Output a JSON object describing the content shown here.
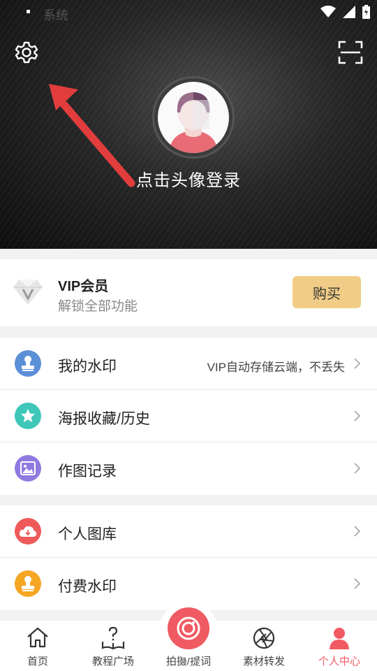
{
  "status_bar": {
    "app_label": "系统"
  },
  "header": {
    "login_prompt": "点击头像登录"
  },
  "vip": {
    "title": "VIP会员",
    "subtitle": "解锁全部功能",
    "buy_label": "购买"
  },
  "group1": [
    {
      "label": "我的水印",
      "note": "VIP自动存储云端，不丢失",
      "icon": "stamp-icon",
      "color": "#5b8fd6"
    },
    {
      "label": "海报收藏/历史",
      "note": "",
      "icon": "star-icon",
      "color": "#3fc7b9"
    },
    {
      "label": "作图记录",
      "note": "",
      "icon": "image-icon",
      "color": "#8f7be0"
    }
  ],
  "group2": [
    {
      "label": "个人图库",
      "icon": "cloud-download-icon",
      "color": "#ee5a5a"
    },
    {
      "label": "付费水印",
      "icon": "stamp-icon",
      "color": "#f5a623"
    }
  ],
  "tabbar": {
    "home": "首页",
    "tutorial": "教程广场",
    "shoot": "拍摄/提词",
    "material": "素材转发",
    "profile": "个人中心",
    "active_color": "#f15a63"
  }
}
